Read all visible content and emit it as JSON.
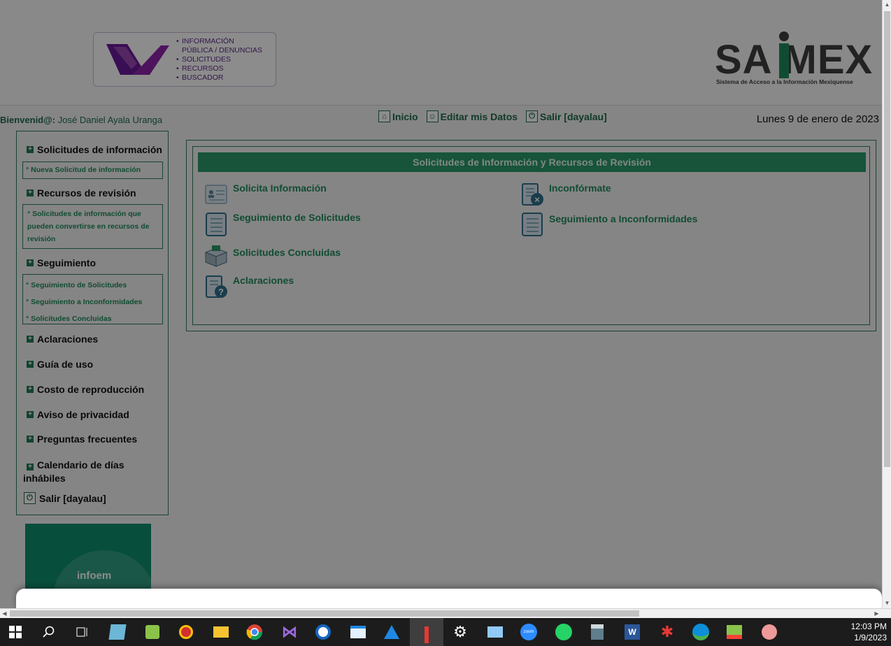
{
  "header": {
    "logo_lines": [
      "INFORMACIÓN",
      "PÚBLICA / DENUNCIAS",
      "SOLICITUDES",
      "RECURSOS",
      "BUSCADOR"
    ],
    "saimex_word": "SA MEX",
    "saimex_subtitle": "Sistema de Acceso a la Información Mexiquense"
  },
  "topbar": {
    "welcome_label": "Bienvenid@:",
    "user_name": "José Daniel Ayala Uranga",
    "nav": {
      "home": "Inicio",
      "edit": "Editar mis Datos",
      "logout": "Salir [dayalau]"
    },
    "date": "Lunes 9 de enero de 2023"
  },
  "sidebar": {
    "sections": {
      "solicitudes": "Solicitudes de información",
      "recursos": "Recursos de revisión",
      "seguimiento": "Seguimiento",
      "aclaraciones": "Aclaraciones",
      "guia": "Guía de uso",
      "costo": "Costo de reproducción",
      "aviso": "Aviso de privacidad",
      "preguntas": "Preguntas frecuentes",
      "calendario": "Calendario de días inhábiles",
      "salir": "Salir [dayalau]"
    },
    "links": {
      "nueva_solicitud": "Nueva Solicitud de información",
      "convertibles": "Solicitudes de información que pueden convertirse en recursos de revisión",
      "seg_solicitudes": "Seguimiento de Solicitudes",
      "seg_inconformidades": "Seguimiento a Inconformidades",
      "concluidas": "Solicitudes Concluidas"
    },
    "banner_text": "infoem"
  },
  "main": {
    "title": "Solicitudes de Información y Recursos de Revisión",
    "items": {
      "solicita": "Solicita Información",
      "inconformate": "Inconfórmate",
      "seg_solicitudes": "Seguimiento de Solicitudes",
      "seg_inconformidades": "Seguimiento a Inconformidades",
      "concluidas": "Solicitudes Concluidas",
      "aclaraciones": "Aclaraciones"
    }
  },
  "taskbar": {
    "time": "12:03 PM",
    "date": "1/9/2023"
  }
}
